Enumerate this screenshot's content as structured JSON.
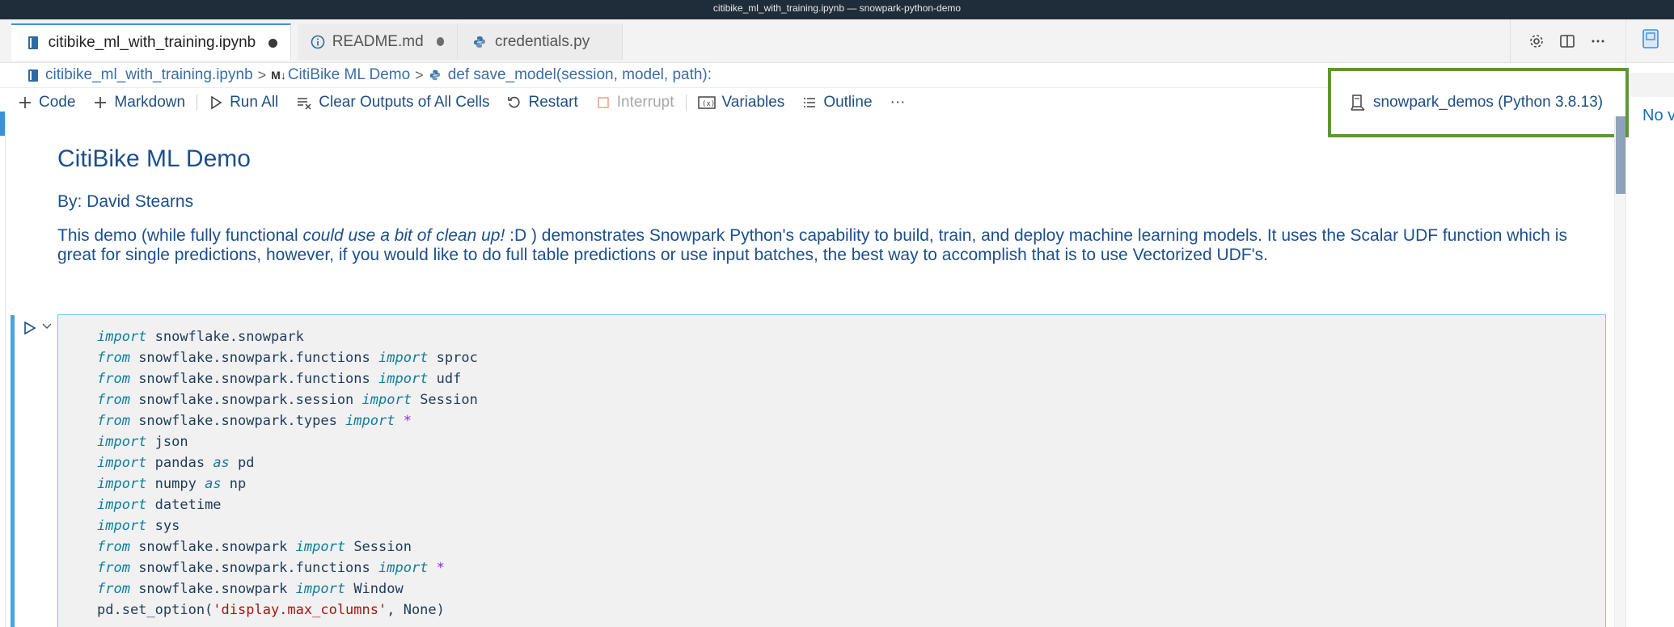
{
  "window": {
    "title": "citibike_ml_with_training.ipynb — snowpark-python-demo"
  },
  "tabs": [
    {
      "label": "citibike_ml_with_training.ipynb",
      "icon": "notebook-icon",
      "modified": true
    },
    {
      "label": "README.md",
      "icon": "info-icon",
      "modified": true
    },
    {
      "label": "credentials.py",
      "icon": "python-icon",
      "modified": false
    }
  ],
  "tab_actions": [
    "gear-icon",
    "split-editor-icon",
    "more-icon"
  ],
  "breadcrumb": {
    "file": "citibike_ml_with_training.ipynb",
    "md_marker": "M↓",
    "section": "CitiBike ML Demo",
    "symbol": "def save_model(session, model, path):"
  },
  "toolbar": {
    "code": "Code",
    "markdown": "Markdown",
    "run_all": "Run All",
    "clear_outputs": "Clear Outputs of All Cells",
    "restart": "Restart",
    "interrupt": "Interrupt",
    "variables": "Variables",
    "outline": "Outline",
    "more": "···"
  },
  "kernel": {
    "label": "snowpark_demos (Python 3.8.13)"
  },
  "right_panel": {
    "text": "No v"
  },
  "markdown_cell": {
    "title": "CitiBike ML Demo",
    "byline": "By: David Stearns",
    "desc_part1": "This demo (while fully functional ",
    "desc_italic": "could use a bit of clean up!",
    "desc_part2": " :D ) demonstrates Snowpark Python's capability to build, train, and deploy machine learning models. It uses the Scalar UDF function which is great for single predictions, however, if you would like to do full table predictions or use input batches, the best way to accomplish that is to use Vectorized UDF's."
  },
  "code_cell": {
    "lines": [
      [
        {
          "t": "import",
          "k": "kw"
        },
        {
          "t": " snowflake.snowpark",
          "k": ""
        }
      ],
      [
        {
          "t": "from",
          "k": "kw"
        },
        {
          "t": " snowflake.snowpark.functions ",
          "k": ""
        },
        {
          "t": "import",
          "k": "kw"
        },
        {
          "t": " sproc",
          "k": ""
        }
      ],
      [
        {
          "t": "from",
          "k": "kw"
        },
        {
          "t": " snowflake.snowpark.functions ",
          "k": ""
        },
        {
          "t": "import",
          "k": "kw"
        },
        {
          "t": " udf",
          "k": ""
        }
      ],
      [
        {
          "t": "from",
          "k": "kw"
        },
        {
          "t": " snowflake.snowpark.session ",
          "k": ""
        },
        {
          "t": "import",
          "k": "kw"
        },
        {
          "t": " Session",
          "k": ""
        }
      ],
      [
        {
          "t": "from",
          "k": "kw"
        },
        {
          "t": " snowflake.snowpark.types ",
          "k": ""
        },
        {
          "t": "import",
          "k": "kw"
        },
        {
          "t": " ",
          "k": ""
        },
        {
          "t": "*",
          "k": "op"
        }
      ],
      [
        {
          "t": "import",
          "k": "kw"
        },
        {
          "t": " json",
          "k": ""
        }
      ],
      [
        {
          "t": "import",
          "k": "kw"
        },
        {
          "t": " pandas ",
          "k": ""
        },
        {
          "t": "as",
          "k": "kw"
        },
        {
          "t": " pd",
          "k": ""
        }
      ],
      [
        {
          "t": "import",
          "k": "kw"
        },
        {
          "t": " numpy ",
          "k": ""
        },
        {
          "t": "as",
          "k": "kw"
        },
        {
          "t": " np",
          "k": ""
        }
      ],
      [
        {
          "t": "import",
          "k": "kw"
        },
        {
          "t": " datetime",
          "k": ""
        }
      ],
      [
        {
          "t": "import",
          "k": "kw"
        },
        {
          "t": " sys",
          "k": ""
        }
      ],
      [
        {
          "t": "from",
          "k": "kw"
        },
        {
          "t": " snowflake.snowpark ",
          "k": ""
        },
        {
          "t": "import",
          "k": "kw"
        },
        {
          "t": " Session",
          "k": ""
        }
      ],
      [
        {
          "t": "from",
          "k": "kw"
        },
        {
          "t": " snowflake.snowpark.functions ",
          "k": ""
        },
        {
          "t": "import",
          "k": "kw"
        },
        {
          "t": " ",
          "k": ""
        },
        {
          "t": "*",
          "k": "op"
        }
      ],
      [
        {
          "t": "from",
          "k": "kw"
        },
        {
          "t": " snowflake.snowpark ",
          "k": ""
        },
        {
          "t": "import",
          "k": "kw"
        },
        {
          "t": " Window",
          "k": ""
        }
      ],
      [
        {
          "t": "pd.set_option(",
          "k": ""
        },
        {
          "t": "'display.max_columns'",
          "k": "str"
        },
        {
          "t": ", None)",
          "k": ""
        }
      ]
    ]
  },
  "colors": {
    "accent": "#4aa3df",
    "kernel_highlight": "#5e9732",
    "link": "#1c4f8c"
  }
}
